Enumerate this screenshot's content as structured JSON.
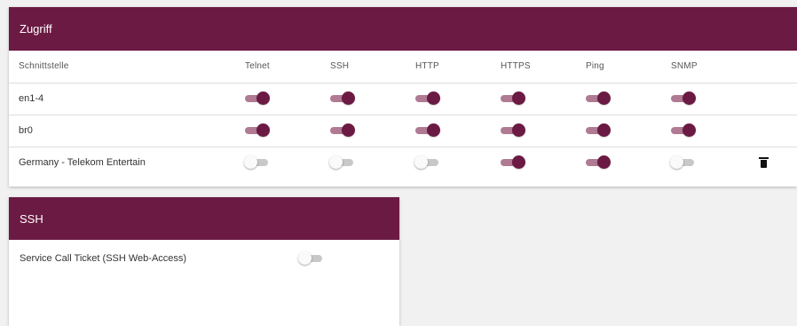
{
  "access": {
    "title": "Zugriff",
    "columns": [
      "Schnittstelle",
      "Telnet",
      "SSH",
      "HTTP",
      "HTTPS",
      "Ping",
      "SNMP"
    ],
    "rows": [
      {
        "name": "en1-4",
        "toggles": [
          true,
          true,
          true,
          true,
          true,
          true
        ],
        "deletable": false
      },
      {
        "name": "br0",
        "toggles": [
          true,
          true,
          true,
          true,
          true,
          true
        ],
        "deletable": false
      },
      {
        "name": "Germany - Telekom Entertain",
        "toggles": [
          false,
          false,
          false,
          true,
          true,
          false
        ],
        "deletable": true
      }
    ]
  },
  "ssh": {
    "title": "SSH",
    "service_call_label": "Service Call Ticket (SSH Web-Access)",
    "service_call_enabled": false
  },
  "colors": {
    "accent": "#6b1a43",
    "toggle_on_track": "#b07a94",
    "toggle_off_track": "#c8c8c8"
  },
  "icons": {
    "delete": "trash-icon"
  }
}
